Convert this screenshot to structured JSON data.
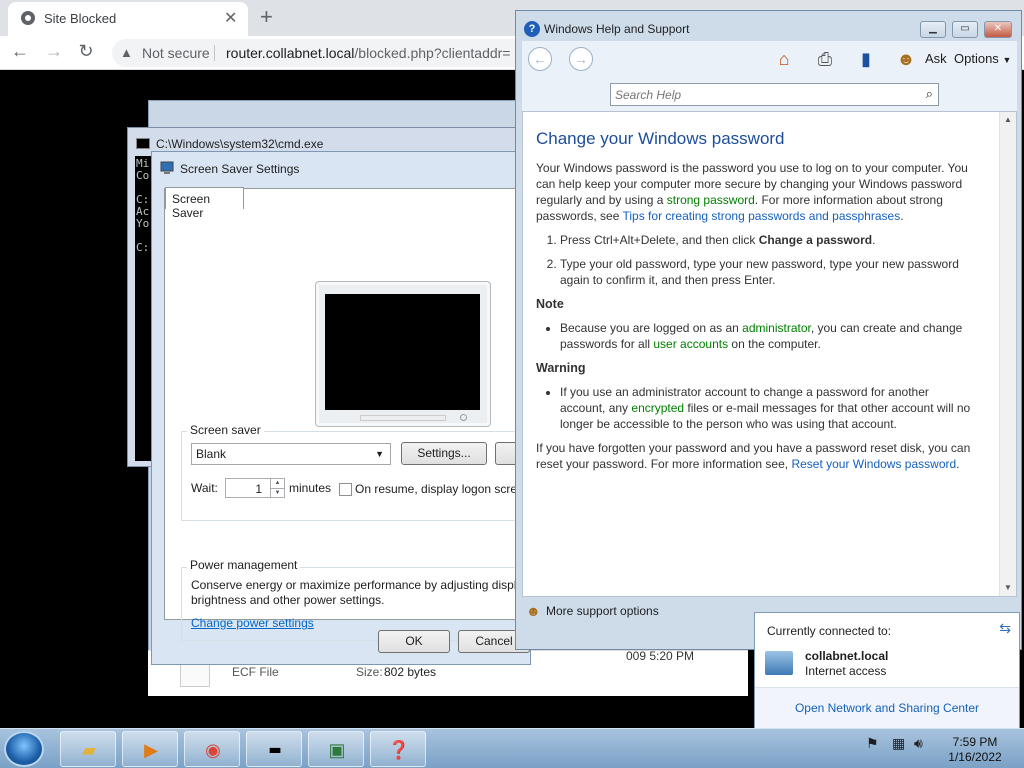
{
  "browser": {
    "tab_title": "Site Blocked",
    "tab_close": "✕",
    "newtab": "+",
    "not_secure": "Not secure",
    "url_host": "router.collabnet.local",
    "url_path": "/blocked.php?clientaddr="
  },
  "cmd": {
    "title": "C:\\Windows\\system32\\cmd.exe",
    "lines": "Mi\nCo\n\nC:\nAc\nYo\n\nC:"
  },
  "screensaver": {
    "title": "Screen Saver Settings",
    "tab": "Screen Saver",
    "group_label": "Screen saver",
    "selected": "Blank",
    "settings_button": "Settings...",
    "wait_label": "Wait:",
    "wait_value": "1",
    "minutes": "minutes",
    "resume_label": "On resume, display logon scre",
    "power_label": "Power management",
    "power_text": "Conserve energy or maximize performance by adjusting displ",
    "power_text2": "brightness and other power settings.",
    "power_link": "Change power settings",
    "ok": "OK",
    "cancel": "Cancel"
  },
  "back": {
    "ecf": "ECF File",
    "size_label": "Size:",
    "size_value": "802 bytes",
    "date": "009 5:20 PM"
  },
  "help": {
    "title": "Windows Help and Support",
    "ask": "Ask",
    "options": "Options",
    "search_placeholder": "Search Help",
    "heading": "Change your Windows password",
    "p1a": "Your Windows password is the password you use to log on to your computer. You can help keep your computer more secure by changing your Windows password regularly and by using a ",
    "p1_link1": "strong password",
    "p1b": ". For more information about strong passwords, see ",
    "p1_link2": "Tips for creating strong passwords and passphrases",
    "p1c": ".",
    "step1a": "Press Ctrl+Alt+Delete, and then click ",
    "step1b": "Change a password",
    "step1c": ".",
    "step2": "Type your old password, type your new password, type your new password again to confirm it, and then press Enter.",
    "note": "Note",
    "note1a": "Because you are logged on as an ",
    "note1_link1": "administrator",
    "note1b": ", you can create and change passwords for all ",
    "note1_link2": "user accounts",
    "note1c": " on the computer.",
    "warning": "Warning",
    "warn1a": "If you use an administrator account to change a password for another account, any ",
    "warn1_link": "encrypted",
    "warn1b": " files or e-mail messages for that other account will no longer be accessible to the person who was using that account.",
    "p2a": "If you have forgotten your password and you have a password reset disk, you can reset your password. For more information see, ",
    "p2_link": "Reset your Windows password",
    "p2b": ".",
    "more_support": "More support options"
  },
  "network": {
    "header": "Currently connected to:",
    "name": "collabnet.local",
    "status": "Internet access",
    "link": "Open Network and Sharing Center"
  },
  "taskbar": {
    "time": "7:59 PM",
    "date": "1/16/2022"
  }
}
